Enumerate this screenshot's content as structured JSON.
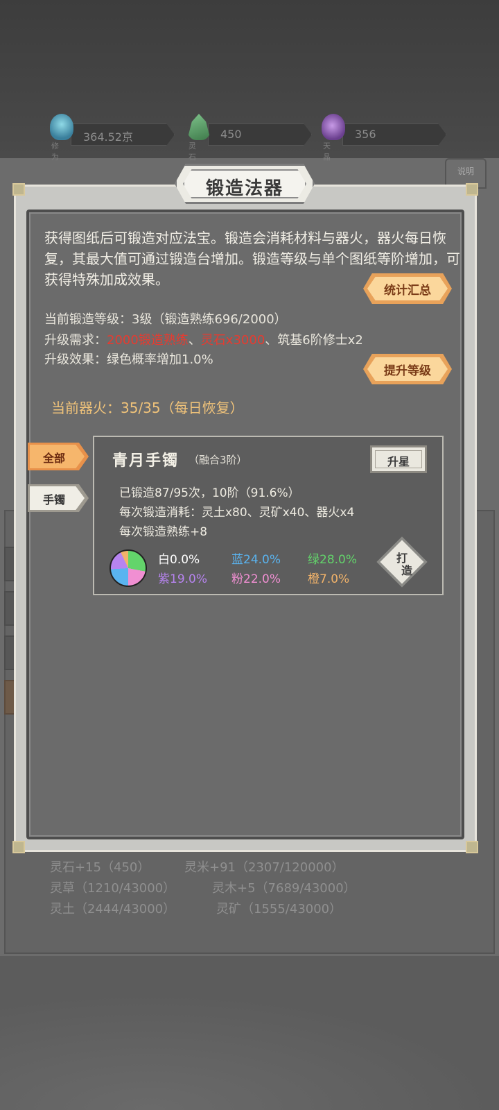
{
  "resources": [
    {
      "label": "修为",
      "value": "364.52京",
      "icon": "cultivation-flame-icon",
      "color": "#4aa7c4"
    },
    {
      "label": "灵石",
      "value": "450",
      "icon": "spirit-stone-crystal-icon",
      "color": "#4f9a62"
    },
    {
      "label": "天晶",
      "value": "356",
      "icon": "sky-crystal-icon",
      "color": "#8e5ab4"
    }
  ],
  "help_peek": "说明",
  "dialog": {
    "title": "锻造法器",
    "description": "获得图纸后可锻造对应法宝。锻造会消耗材料与器火，器火每日恢复，其最大值可通过锻造台增加。锻造等级与单个图纸等阶增加，可获得特殊加成效果。",
    "stats_button": "统计汇总",
    "level_line": "当前锻造等级：3级（锻造熟练696/2000）",
    "req_prefix": "升级需求：",
    "req_red1": "2000锻造熟练",
    "req_sep1": "、",
    "req_red2": "灵石x3000",
    "req_rest": "、筑基6阶修士x2",
    "effect_line": "升级效果：绿色概率增加1.0%",
    "upgrade_button": "提升等级",
    "fire_line": "当前器火：35/35（每日恢复）"
  },
  "tabs": [
    {
      "label": "全部",
      "active": true
    },
    {
      "label": "手镯",
      "active": false
    }
  ],
  "item": {
    "name": "青月手镯",
    "sub": "（融合3阶）",
    "star_button": "升星",
    "forged_line": "已锻造87/95次，10阶（91.6%）",
    "cost_line": "每次锻造消耗：灵土x80、灵矿x40、器火x4",
    "skill_line": "每次锻造熟练+8",
    "forge_button_top": "打",
    "forge_button_bottom": "造",
    "rates": [
      {
        "label": "白0.0%",
        "value": 0.0,
        "color": "#ffffff"
      },
      {
        "label": "蓝24.0%",
        "value": 24.0,
        "color": "#5ab4f0"
      },
      {
        "label": "绿28.0%",
        "value": 28.0,
        "color": "#63d46b"
      },
      {
        "label": "紫19.0%",
        "value": 19.0,
        "color": "#b784f0"
      },
      {
        "label": "粉22.0%",
        "value": 22.0,
        "color": "#f08fd2"
      },
      {
        "label": "橙7.0%",
        "value": 7.0,
        "color": "#f2b36a"
      }
    ]
  },
  "background_resources": [
    "灵石+15（450）",
    "灵米+91（2307/120000）",
    "灵草（1210/43000）",
    "灵木+5（7689/43000）",
    "灵土（2444/43000）",
    "灵矿（1555/43000）"
  ]
}
